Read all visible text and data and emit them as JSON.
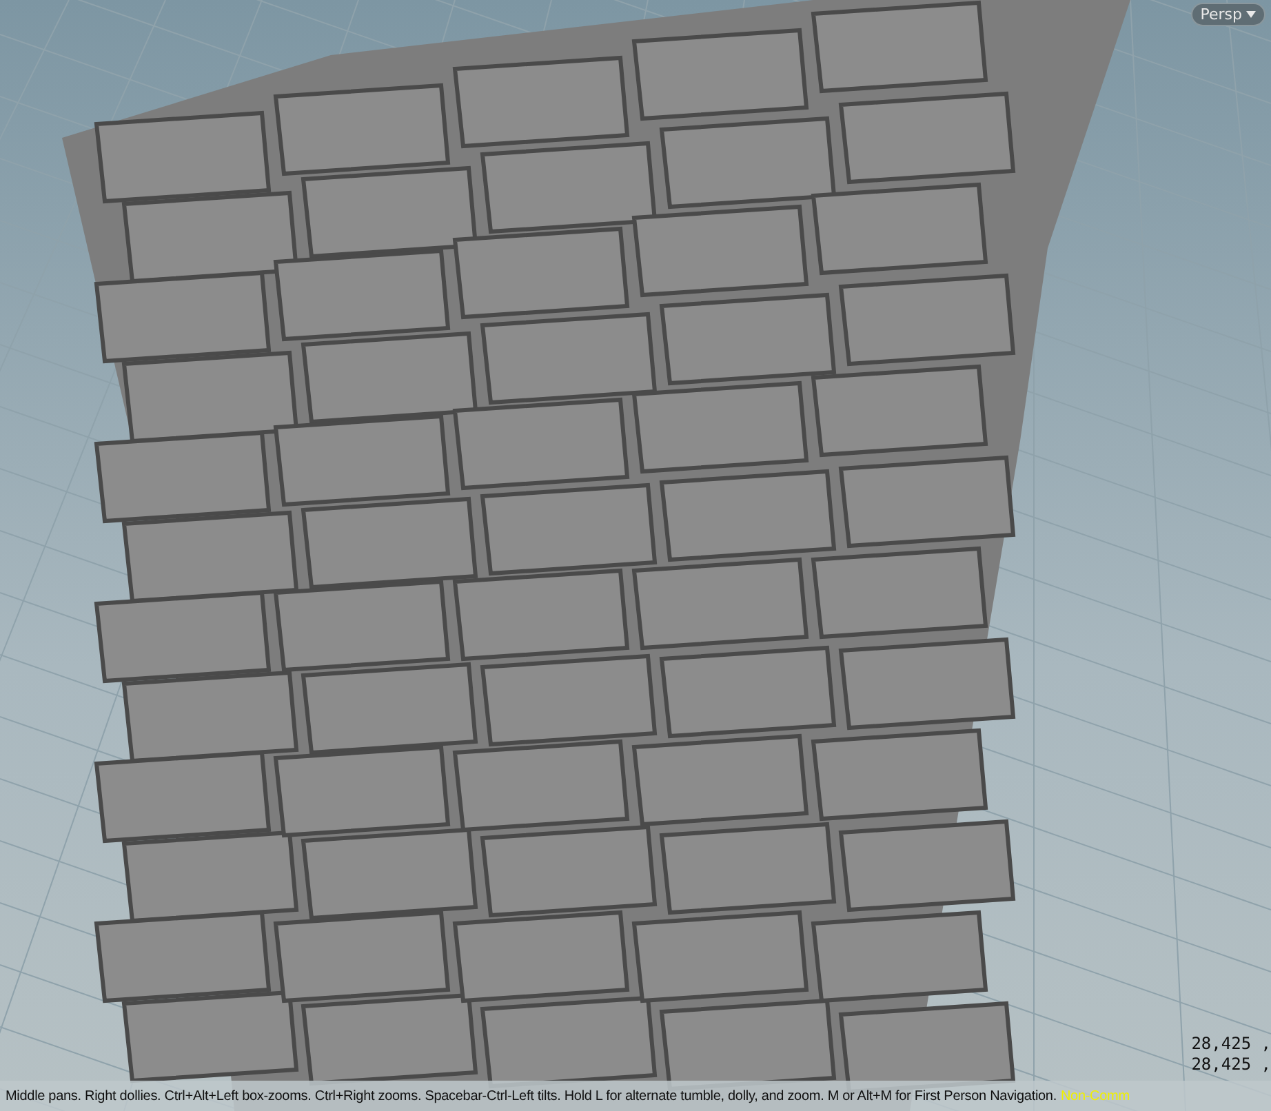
{
  "viewport": {
    "camera_menu": "Persp",
    "readout": [
      "28,425 ,",
      "28,425 ,"
    ]
  },
  "status_bar": {
    "hint": "Middle pans. Right dollies. Ctrl+Alt+Left box-zooms. Ctrl+Right zooms. Spacebar-Ctrl-Left tilts. Hold L for alternate tumble, dolly, and zoom. M or Alt+M for First Person Navigation.",
    "license": "Non-Comm"
  }
}
